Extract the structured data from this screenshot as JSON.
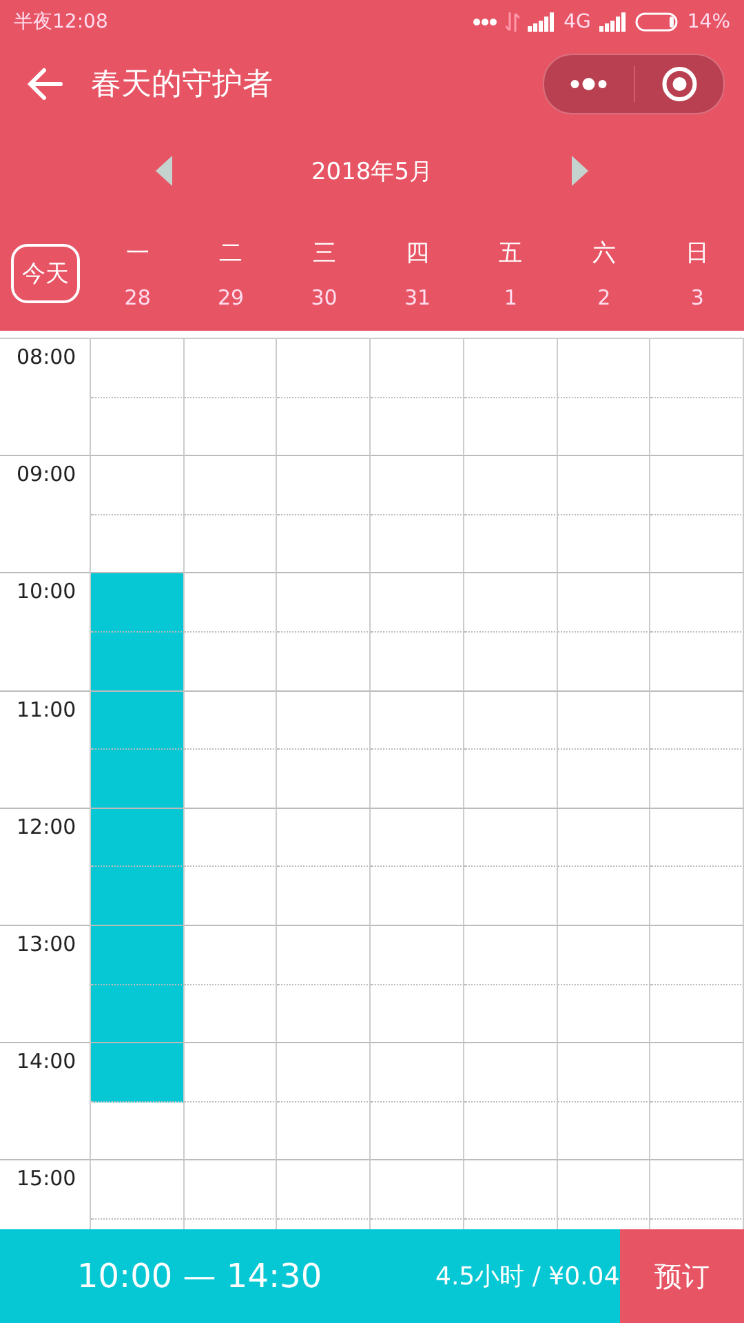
{
  "status_bar": {
    "time": "半夜12:08",
    "network": "4G",
    "battery": "14%"
  },
  "header": {
    "title": "春天的守护者"
  },
  "month_nav": {
    "label": "2018年5月"
  },
  "today_button": "今天",
  "days": [
    {
      "weekday": "一",
      "date": "28"
    },
    {
      "weekday": "二",
      "date": "29"
    },
    {
      "weekday": "三",
      "date": "30"
    },
    {
      "weekday": "四",
      "date": "31"
    },
    {
      "weekday": "五",
      "date": "1"
    },
    {
      "weekday": "六",
      "date": "2"
    },
    {
      "weekday": "日",
      "date": "3"
    }
  ],
  "hours": [
    {
      "time": "08:00",
      "halves": [
        [
          {
            "selected": false
          },
          {
            "selected": false
          },
          {
            "selected": false
          },
          {
            "selected": false
          },
          {
            "selected": false
          },
          {
            "selected": false
          },
          {
            "selected": false
          }
        ],
        [
          {
            "selected": false
          },
          {
            "selected": false
          },
          {
            "selected": false
          },
          {
            "selected": false
          },
          {
            "selected": false
          },
          {
            "selected": false
          },
          {
            "selected": false
          }
        ]
      ]
    },
    {
      "time": "09:00",
      "halves": [
        [
          {
            "selected": false
          },
          {
            "selected": false
          },
          {
            "selected": false
          },
          {
            "selected": false
          },
          {
            "selected": false
          },
          {
            "selected": false
          },
          {
            "selected": false
          }
        ],
        [
          {
            "selected": false
          },
          {
            "selected": false
          },
          {
            "selected": false
          },
          {
            "selected": false
          },
          {
            "selected": false
          },
          {
            "selected": false
          },
          {
            "selected": false
          }
        ]
      ]
    },
    {
      "time": "10:00",
      "halves": [
        [
          {
            "selected": true
          },
          {
            "selected": false
          },
          {
            "selected": false
          },
          {
            "selected": false
          },
          {
            "selected": false
          },
          {
            "selected": false
          },
          {
            "selected": false
          }
        ],
        [
          {
            "selected": true
          },
          {
            "selected": false
          },
          {
            "selected": false
          },
          {
            "selected": false
          },
          {
            "selected": false
          },
          {
            "selected": false
          },
          {
            "selected": false
          }
        ]
      ]
    },
    {
      "time": "11:00",
      "halves": [
        [
          {
            "selected": true
          },
          {
            "selected": false
          },
          {
            "selected": false
          },
          {
            "selected": false
          },
          {
            "selected": false
          },
          {
            "selected": false
          },
          {
            "selected": false
          }
        ],
        [
          {
            "selected": true
          },
          {
            "selected": false
          },
          {
            "selected": false
          },
          {
            "selected": false
          },
          {
            "selected": false
          },
          {
            "selected": false
          },
          {
            "selected": false
          }
        ]
      ]
    },
    {
      "time": "12:00",
      "halves": [
        [
          {
            "selected": true
          },
          {
            "selected": false
          },
          {
            "selected": false
          },
          {
            "selected": false
          },
          {
            "selected": false
          },
          {
            "selected": false
          },
          {
            "selected": false
          }
        ],
        [
          {
            "selected": true
          },
          {
            "selected": false
          },
          {
            "selected": false
          },
          {
            "selected": false
          },
          {
            "selected": false
          },
          {
            "selected": false
          },
          {
            "selected": false
          }
        ]
      ]
    },
    {
      "time": "13:00",
      "halves": [
        [
          {
            "selected": true
          },
          {
            "selected": false
          },
          {
            "selected": false
          },
          {
            "selected": false
          },
          {
            "selected": false
          },
          {
            "selected": false
          },
          {
            "selected": false
          }
        ],
        [
          {
            "selected": true
          },
          {
            "selected": false
          },
          {
            "selected": false
          },
          {
            "selected": false
          },
          {
            "selected": false
          },
          {
            "selected": false
          },
          {
            "selected": false
          }
        ]
      ]
    },
    {
      "time": "14:00",
      "halves": [
        [
          {
            "selected": true
          },
          {
            "selected": false
          },
          {
            "selected": false
          },
          {
            "selected": false
          },
          {
            "selected": false
          },
          {
            "selected": false
          },
          {
            "selected": false
          }
        ],
        [
          {
            "selected": false
          },
          {
            "selected": false
          },
          {
            "selected": false
          },
          {
            "selected": false
          },
          {
            "selected": false
          },
          {
            "selected": false
          },
          {
            "selected": false
          }
        ]
      ]
    },
    {
      "time": "15:00",
      "halves": [
        [
          {
            "selected": false
          },
          {
            "selected": false
          },
          {
            "selected": false
          },
          {
            "selected": false
          },
          {
            "selected": false
          },
          {
            "selected": false
          },
          {
            "selected": false
          }
        ],
        [
          {
            "selected": false
          },
          {
            "selected": false
          },
          {
            "selected": false
          },
          {
            "selected": false
          },
          {
            "selected": false
          },
          {
            "selected": false
          },
          {
            "selected": false
          }
        ]
      ]
    }
  ],
  "booking_bar": {
    "time_range": "10:00 — 14:30",
    "summary": "4.5小时 / ¥0.04",
    "button": "预订"
  }
}
